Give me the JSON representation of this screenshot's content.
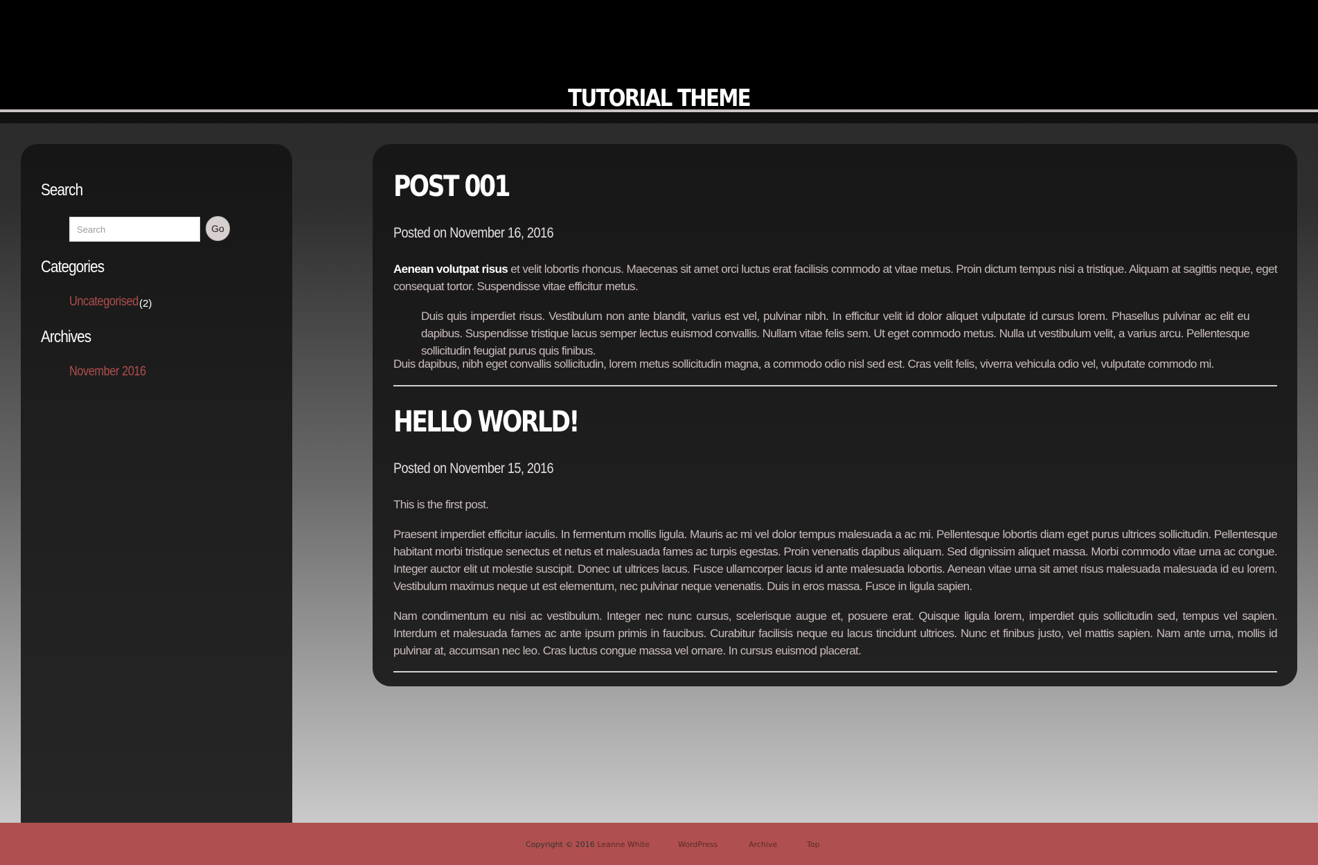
{
  "header": {
    "site_title": "TUTORIAL THEME"
  },
  "sidebar": {
    "search": {
      "title": "Search",
      "placeholder": "Search",
      "button_label": "Go"
    },
    "categories": {
      "title": "Categories",
      "items": [
        {
          "label": "Uncategorised",
          "count": "(2)"
        }
      ]
    },
    "archives": {
      "title": "Archives",
      "items": [
        {
          "label": "November 2016"
        }
      ]
    }
  },
  "posts": [
    {
      "title": "POST 001",
      "meta": "Posted on November 16, 2016",
      "lead_bold": "Aenean volutpat risus",
      "lead_rest": " et velit lobortis rhoncus. Maecenas sit amet orci luctus erat facilisis commodo at vitae metus. Proin dictum tempus nisi a tristique. Aliquam at sagittis neque, eget consequat tortor. Suspendisse vitae efficitur metus.",
      "quote": "Duis quis imperdiet risus. Vestibulum non ante blandit, varius est vel, pulvinar nibh. In efficitur velit id dolor aliquet vulputate id cursus lorem. Phasellus pulvinar ac elit eu dapibus. Suspendisse tristique lacus semper lectus euismod convallis. Nullam vitae felis sem. Ut eget commodo metus. Nulla ut vestibulum velit, a varius arcu. Pellentesque sollicitudin feugiat purus quis finibus.",
      "closing": "Duis dapibus, nibh eget convallis sollicitudin, lorem metus sollicitudin magna, a commodo odio nisl sed est. Cras velit felis, viverra vehicula odio vel, vulputate commodo mi."
    },
    {
      "title": "HELLO WORLD!",
      "meta": "Posted on November 15, 2016",
      "p1": "This is the first post.",
      "p2": "Praesent imperdiet efficitur iaculis. In fermentum mollis ligula. Mauris ac mi vel dolor tempus malesuada a ac mi. Pellentesque lobortis diam eget purus ultrices sollicitudin. Pellentesque habitant morbi tristique senectus et netus et malesuada fames ac turpis egestas. Proin venenatis dapibus aliquam. Sed dignissim aliquet massa. Morbi commodo vitae urna ac congue. Integer auctor elit ut molestie suscipit. Donec ut ultrices lacus. Fusce ullamcorper lacus id ante malesuada lobortis. Aenean vitae urna sit amet risus malesuada malesuada id eu lorem. Vestibulum maximus neque ut est elementum, nec pulvinar neque venenatis. Duis in eros massa. Fusce in ligula sapien.",
      "p3": "Nam condimentum eu nisi ac vestibulum. Integer nec nunc cursus, scelerisque augue et, posuere erat. Quisque ligula lorem, imperdiet quis sollicitudin sed, tempus vel sapien. Interdum et malesuada fames ac ante ipsum primis in faucibus. Curabitur facilisis neque eu lacus tincidunt ultrices. Nunc et finibus justo, vel mattis sapien. Nam ante urna, mollis id pulvinar at, accumsan nec leo. Cras luctus congue massa vel ornare. In cursus euismod placerat."
    }
  ],
  "footer": {
    "copyright": "Copyright © 2016",
    "author": "Leanne White",
    "links": [
      "WordPress",
      "Archive",
      "Top"
    ]
  },
  "colors": {
    "accent": "#b04f4f",
    "header_bg": "#000000",
    "panel_bg": "#1f1f1f"
  }
}
